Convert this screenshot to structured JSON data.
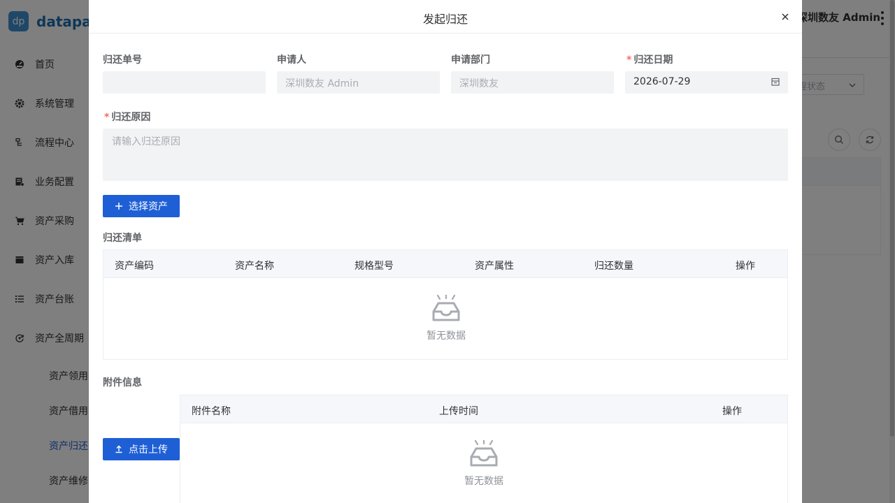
{
  "app": {
    "logo_badge": "dp",
    "logo_text": "datapart",
    "user_name": "深圳数友 Admin",
    "bg_select_placeholder": "程状态"
  },
  "sidebar": {
    "items": [
      {
        "label": "首页",
        "icon": "dashboard-icon"
      },
      {
        "label": "系统管理",
        "icon": "gear-icon"
      },
      {
        "label": "流程中心",
        "icon": "flow-icon"
      },
      {
        "label": "业务配置",
        "icon": "config-icon"
      },
      {
        "label": "资产采购",
        "icon": "cart-icon"
      },
      {
        "label": "资产入库",
        "icon": "film-icon"
      },
      {
        "label": "资产台账",
        "icon": "list-icon"
      },
      {
        "label": "资产全周期",
        "icon": "cycle-icon"
      }
    ],
    "sub_items": [
      {
        "label": "资产领用"
      },
      {
        "label": "资产借用"
      },
      {
        "label": "资产归还"
      },
      {
        "label": "资产维修"
      }
    ]
  },
  "dialog": {
    "title": "发起归还",
    "fields": {
      "return_no": {
        "label": "归还单号",
        "value": ""
      },
      "applicant": {
        "label": "申请人",
        "placeholder": "深圳数友 Admin"
      },
      "department": {
        "label": "申请部门",
        "placeholder": "深圳数友"
      },
      "return_date": {
        "label": "归还日期",
        "value": "2026-07-29"
      },
      "reason": {
        "label": "归还原因",
        "placeholder": "请输入归还原因"
      }
    },
    "select_asset_button": "选择资产",
    "return_list": {
      "title": "归还清单",
      "columns": [
        "资产编码",
        "资产名称",
        "规格型号",
        "资产属性",
        "归还数量",
        "操作"
      ],
      "empty_text": "暂无数据"
    },
    "attachments": {
      "title": "附件信息",
      "upload_button": "点击上传",
      "columns": [
        "附件名称",
        "上传时间",
        "操作"
      ],
      "empty_text": "暂无数据"
    }
  }
}
